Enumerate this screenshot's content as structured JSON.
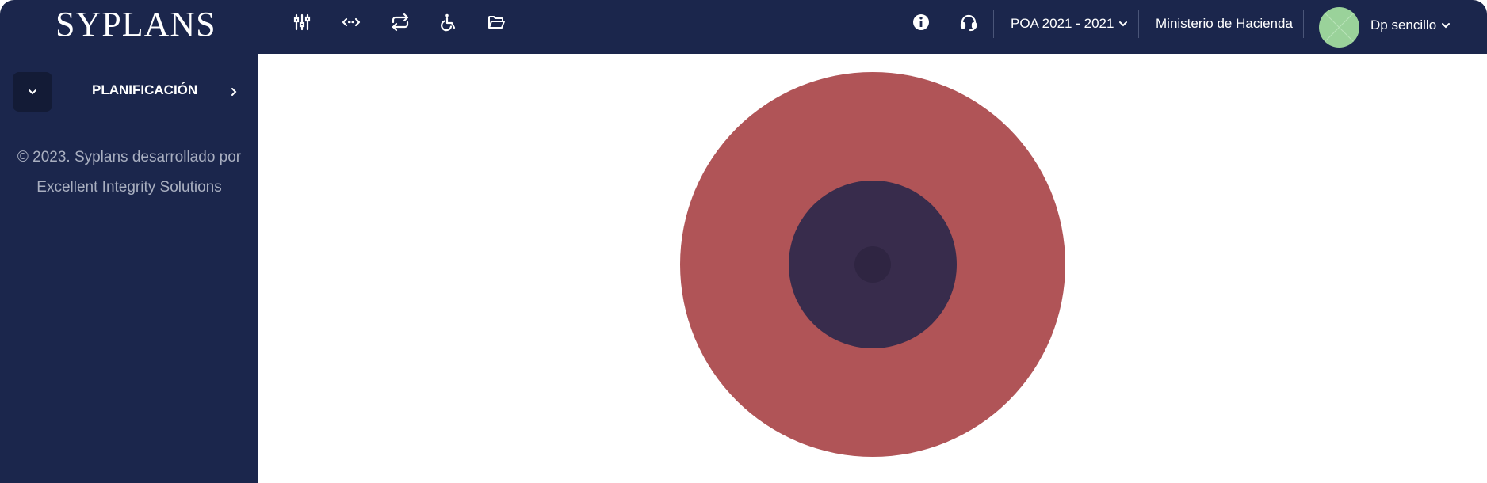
{
  "app": {
    "brand": "SYPLANS"
  },
  "toolbar": {
    "icons": [
      "sliders-icon",
      "arrows-horizontal-icon",
      "repeat-icon",
      "wheelchair-icon",
      "folder-open-icon"
    ]
  },
  "header": {
    "info_icon": "info-icon",
    "support_icon": "headset-icon",
    "period_label": "POA 2021 - 2021",
    "organization_label": "Ministerio de Hacienda",
    "user_name": "Dp sencillo"
  },
  "sidebar": {
    "section_label": "PLANIFICACIÓN",
    "footer_line1": "© 2023. Syplans desarrollado por",
    "footer_line2": "Excellent Integrity Solutions"
  },
  "loader": {
    "outer_color": "#b05457",
    "inner_color": "#382c4c",
    "core_color": "#2f2542"
  },
  "colors": {
    "navy": "#1b264c",
    "avatar": "#9ad29a"
  }
}
